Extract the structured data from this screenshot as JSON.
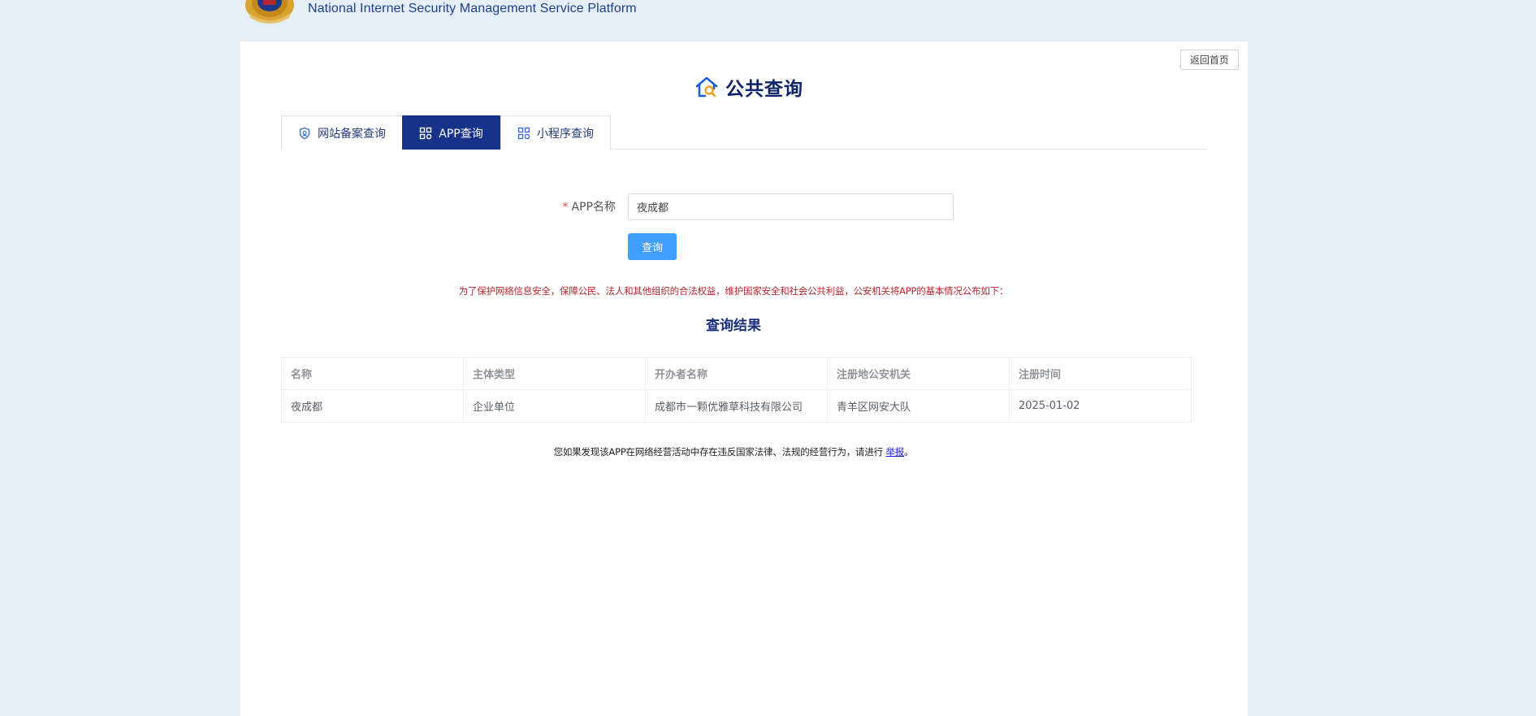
{
  "header": {
    "title": "National Internet Security Management Service Platform",
    "emblem": "police-emblem"
  },
  "card": {
    "back_home_label": "返回首页",
    "heading": "公共查询",
    "heading_icon": "house-search-icon"
  },
  "tabs": [
    {
      "label": "网站备案查询",
      "icon": "shield-icon",
      "active": false
    },
    {
      "label": "APP查询",
      "icon": "grid-icon",
      "active": true
    },
    {
      "label": "小程序查询",
      "icon": "grid-icon",
      "active": false
    }
  ],
  "form": {
    "required_mark": "*",
    "label": "APP名称",
    "value": "夜成都",
    "search_label": "查询"
  },
  "notice": "为了保护网络信息安全，保障公民、法人和其他组织的合法权益，维护国家安全和社会公共利益，公安机关将APP的基本情况公布如下：",
  "result_title": "查询结果",
  "table": {
    "headers": [
      "名称",
      "主体类型",
      "开办者名称",
      "注册地公安机关",
      "注册时间"
    ],
    "rows": [
      [
        "夜成都",
        "企业单位",
        "成都市一颗优雅草科技有限公司",
        "青羊区网安大队",
        "2025-01-02"
      ]
    ]
  },
  "footer": {
    "text": "您如果发现该APP在网络经营活动中存在违反国家法律、法规的经营行为，请进行",
    "link": "举报",
    "end": "。"
  },
  "colors": {
    "page_bg": "#e6eff8",
    "tab_active": "#173289",
    "button": "#409eff",
    "notice": "#b3262d"
  }
}
